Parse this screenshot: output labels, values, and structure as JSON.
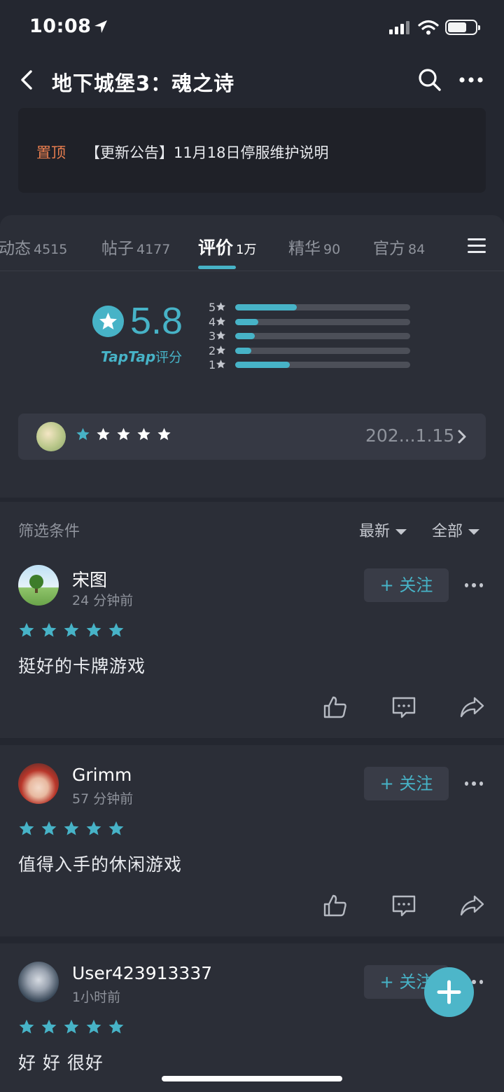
{
  "status_bar": {
    "time": "10:08"
  },
  "nav": {
    "title": "地下城堡3：魂之诗"
  },
  "pinned": {
    "tag": "置顶",
    "text": "【更新公告】11月18日停服维护说明"
  },
  "tabs": [
    {
      "label": "动态",
      "count": "4515"
    },
    {
      "label": "帖子",
      "count": "4177"
    },
    {
      "label": "评价",
      "count": "1万",
      "active": true
    },
    {
      "label": "精华",
      "count": "90"
    },
    {
      "label": "官方",
      "count": "84"
    }
  ],
  "rating": {
    "score": "5.8",
    "brand": "TapTap",
    "brand_suffix": "评分",
    "distribution": [
      {
        "label": "5",
        "fraction": 0.35
      },
      {
        "label": "4",
        "fraction": 0.13
      },
      {
        "label": "3",
        "fraction": 0.11
      },
      {
        "label": "2",
        "fraction": 0.09
      },
      {
        "label": "1",
        "fraction": 0.31
      }
    ],
    "my_rating": {
      "stars": 1,
      "date": "202...1.15"
    }
  },
  "filter": {
    "label": "筛选条件",
    "sort": "最新",
    "scope": "全部"
  },
  "reviews": [
    {
      "name": "宋图",
      "time": "24 分钟前",
      "stars": 5,
      "text": "挺好的卡牌游戏",
      "follow_label": "关注"
    },
    {
      "name": "Grimm",
      "time": "57 分钟前",
      "stars": 5,
      "text": "值得入手的休闲游戏",
      "follow_label": "关注"
    },
    {
      "name": "User423913337",
      "time": "1小时前",
      "stars": 5,
      "text": "好 好 很好",
      "follow_label": "关注"
    }
  ],
  "colors": {
    "accent": "#47b3c7",
    "pinned_tag": "#e87e4f",
    "background": "#242730",
    "card": "#2b2e37"
  }
}
